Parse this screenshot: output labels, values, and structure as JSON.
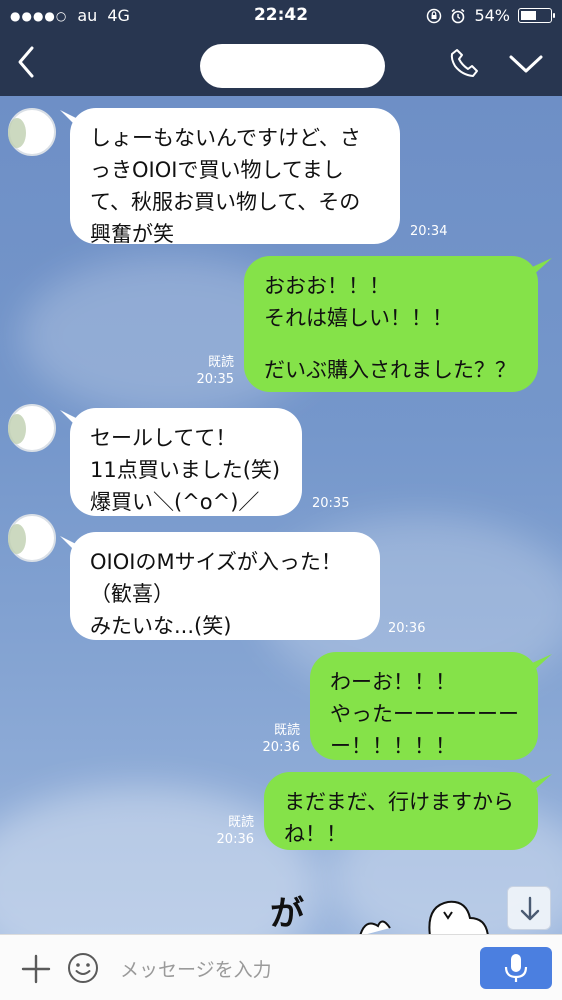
{
  "status_bar": {
    "signal": "●●●●○",
    "carrier": "au",
    "network": "4G",
    "time": "22:42",
    "battery_percent": "54%",
    "battery_level": 0.54
  },
  "header": {
    "back_icon": "chevron-left-icon",
    "call_icon": "phone-icon",
    "menu_icon": "chevron-down-icon"
  },
  "messages": [
    {
      "side": "in",
      "lines": [
        "しょーもないんですけど、さ",
        "っきOIOIで買い物してまし",
        "て、秋服お買い物して、その",
        "興奮が笑"
      ],
      "time": "20:34"
    },
    {
      "side": "out",
      "lines": [
        "おおお！！！",
        "それは嬉しい！！！",
        "",
        "だいぶ購入されました？？"
      ],
      "read": "既読",
      "time": "20:35"
    },
    {
      "side": "in",
      "lines": [
        "セールしてて！",
        "11点買いました(笑)",
        "爆買い＼(^o^)／"
      ],
      "time": "20:35"
    },
    {
      "side": "in",
      "lines": [
        "OIOIのMサイズが入った！",
        "（歓喜）",
        "みたいな...(笑)"
      ],
      "time": "20:36"
    },
    {
      "side": "out",
      "lines": [
        "わーお！！！",
        "やったーーーーーー",
        "ー！！！！！"
      ],
      "read": "既読",
      "time": "20:36"
    },
    {
      "side": "out",
      "lines": [
        "まだまだ、行けますから",
        "ね！！"
      ],
      "read": "既読",
      "time": "20:36"
    }
  ],
  "sticker_text": "が",
  "input": {
    "placeholder": "メッセージを入力"
  },
  "colors": {
    "header_bg": "#283650",
    "outgoing_bubble": "#85e249",
    "incoming_bubble": "#ffffff",
    "mic_button": "#4b7fe0"
  }
}
